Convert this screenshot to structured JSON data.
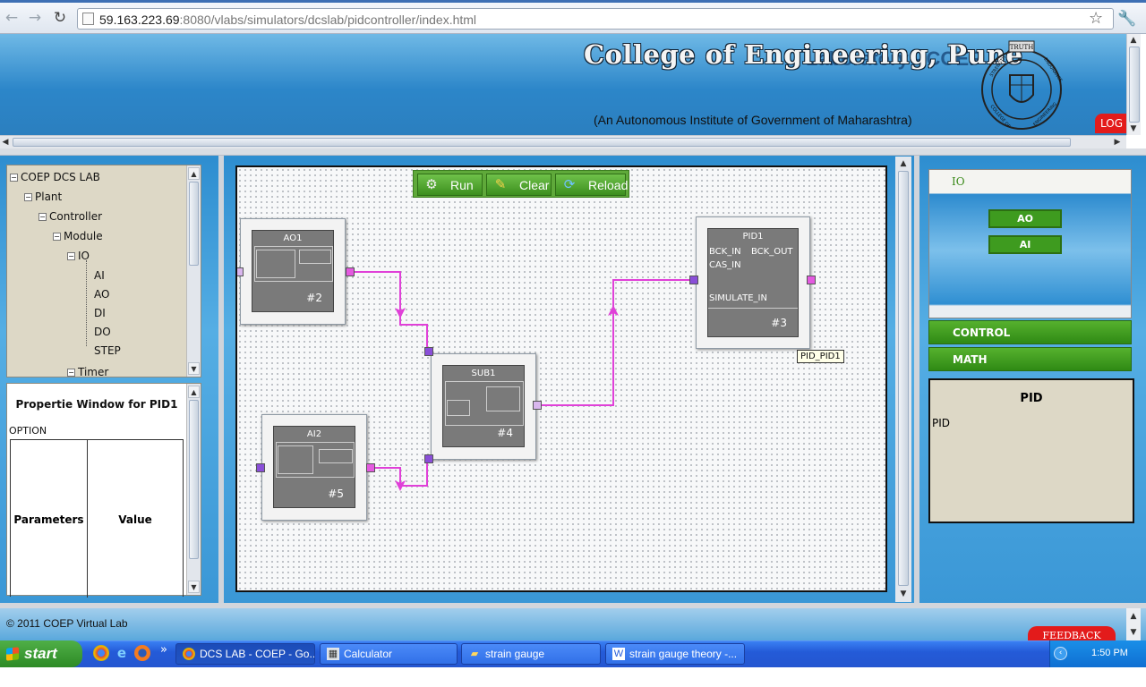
{
  "browser": {
    "url_host": "59.163.223.69",
    "url_rest": ":8080/vlabs/simulators/dcslab/pidcontroller/index.html",
    "back_icon": "back-arrow-icon",
    "forward_icon": "forward-arrow-icon",
    "reload_icon": "reload-icon",
    "star_icon": "star-icon",
    "wrench_icon": "wrench-icon"
  },
  "header": {
    "college_name": "College of Engineering, Pune",
    "lab_title": "Laboratory - COEP",
    "subtitle": "(An Autonomous Institute of Government of Maharashtra)",
    "crest_motto_top": "TRUTH",
    "crest_motto_left": "STRENGTH",
    "crest_motto_right": "ENDURANCE",
    "crest_motto_bottom_left": "COLLEGE OF",
    "crest_motto_bottom_right": "ENGINEERING",
    "logout_label": "LOG"
  },
  "tree": {
    "items": [
      {
        "label": "COEP DCS LAB",
        "toggle": "⊟"
      },
      {
        "label": "Plant",
        "toggle": "⊟"
      },
      {
        "label": "Controller",
        "toggle": "⊟"
      },
      {
        "label": "Module",
        "toggle": "⊟"
      },
      {
        "label": "IO",
        "toggle": "⊟"
      },
      {
        "label": "AI"
      },
      {
        "label": "AO"
      },
      {
        "label": "DI"
      },
      {
        "label": "DO"
      },
      {
        "label": "STEP"
      },
      {
        "label": "Timer",
        "toggle": "⊟"
      }
    ]
  },
  "properties": {
    "title": "Propertie Window for PID1",
    "option_label": "OPTION",
    "col_parameters": "Parameters",
    "col_value": "Value"
  },
  "canvas": {
    "toolbar": {
      "run_label": "Run",
      "clear_label": "Clear",
      "reload_label": "Reload"
    },
    "blocks": {
      "ao1": {
        "name": "AO1",
        "number": "#2"
      },
      "ai2": {
        "name": "AI2",
        "number": "#5"
      },
      "sub1": {
        "name": "SUB1",
        "number": "#4"
      },
      "pid1": {
        "name": "PID1",
        "number": "#3",
        "port_bck_in": "BCK_IN",
        "port_bck_out": "BCK_OUT",
        "port_cas_in": "CAS_IN",
        "port_simulate_in": "SIMULATE_IN"
      }
    },
    "tooltip": "PID_PID1",
    "wire_color": "#e040d8"
  },
  "right_panel": {
    "io_title": "IO",
    "io_buttons": [
      "AO",
      "AI"
    ],
    "control_label": "CONTROL",
    "math_label": "MATH",
    "desc_title": "PID",
    "desc_text": "PID"
  },
  "footer": {
    "copyright": "© 2011 COEP Virtual Lab",
    "feedback_label": "FEEDBACK"
  },
  "taskbar": {
    "start_label": "start",
    "more_label": "»",
    "tasks": [
      {
        "label": "DCS LAB - COEP - Go...",
        "icon": "chrome-icon"
      },
      {
        "label": "Calculator",
        "icon": "calculator-icon"
      },
      {
        "label": "strain gauge",
        "icon": "folder-icon"
      },
      {
        "label": "strain gauge theory -...",
        "icon": "document-icon"
      }
    ],
    "clock": "1:50 PM"
  }
}
